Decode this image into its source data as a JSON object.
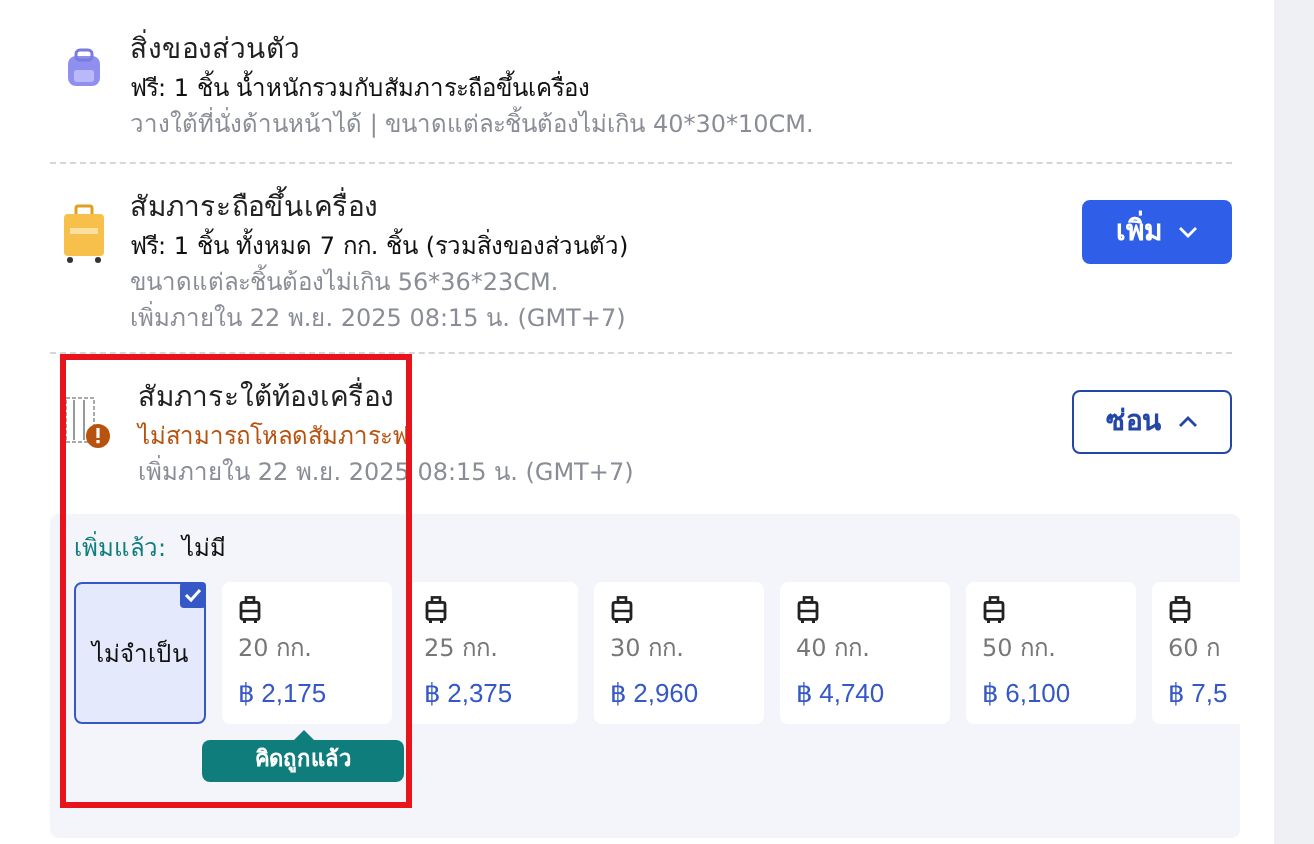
{
  "items": [
    {
      "kind": "personal",
      "title": "สิ่งของส่วนตัว",
      "free": "ฟรี: 1 ชิ้น น้ำหนักรวมกับสัมภาระถือขึ้นเครื่อง",
      "notes": [
        "วางใต้ที่นั่งด้านหน้าได้ | ขนาดแต่ละชิ้นต้องไม่เกิน 40*30*10CM."
      ]
    },
    {
      "kind": "cabin",
      "title": "สัมภาระถือขึ้นเครื่อง",
      "free": "ฟรี: 1 ชิ้น ทั้งหมด 7 กก. ชิ้น (รวมสิ่งของส่วนตัว)",
      "notes": [
        "ขนาดแต่ละชิ้นต้องไม่เกิน 56*36*23CM.",
        "เพิ่มภายใน 22 พ.ย. 2025 08:15 น. (GMT+7)"
      ],
      "button": {
        "label": "เพิ่ม",
        "kind": "add",
        "expanded": false
      }
    },
    {
      "kind": "checked",
      "title": "สัมภาระใต้ท้องเครื่อง",
      "warning": "ไม่สามารถโหลดสัมภาระฟ",
      "notes": [
        "เพิ่มภายใน 22 พ.ย. 2025 08:15 น. (GMT+7)"
      ],
      "button": {
        "label": "ซ่อน",
        "kind": "hide",
        "expanded": true
      }
    }
  ],
  "options_panel": {
    "added_label": "เพิ่มแล้ว:",
    "added_value": "ไม่มี",
    "options": [
      {
        "kind": "none",
        "label": "ไม่จำเป็น",
        "selected": true
      },
      {
        "kind": "weight",
        "weight": "20 กก.",
        "price": "฿ 2,175",
        "selected": false
      },
      {
        "kind": "weight",
        "weight": "25 กก.",
        "price": "฿ 2,375",
        "selected": false
      },
      {
        "kind": "weight",
        "weight": "30 กก.",
        "price": "฿ 2,960",
        "selected": false
      },
      {
        "kind": "weight",
        "weight": "40 กก.",
        "price": "฿ 4,740",
        "selected": false
      },
      {
        "kind": "weight",
        "weight": "50 กก.",
        "price": "฿ 6,100",
        "selected": false
      },
      {
        "kind": "weight",
        "weight": "60 ก",
        "price": "฿ 7,5",
        "selected": false
      }
    ],
    "tooltip": "คิดถูกแล้ว"
  }
}
